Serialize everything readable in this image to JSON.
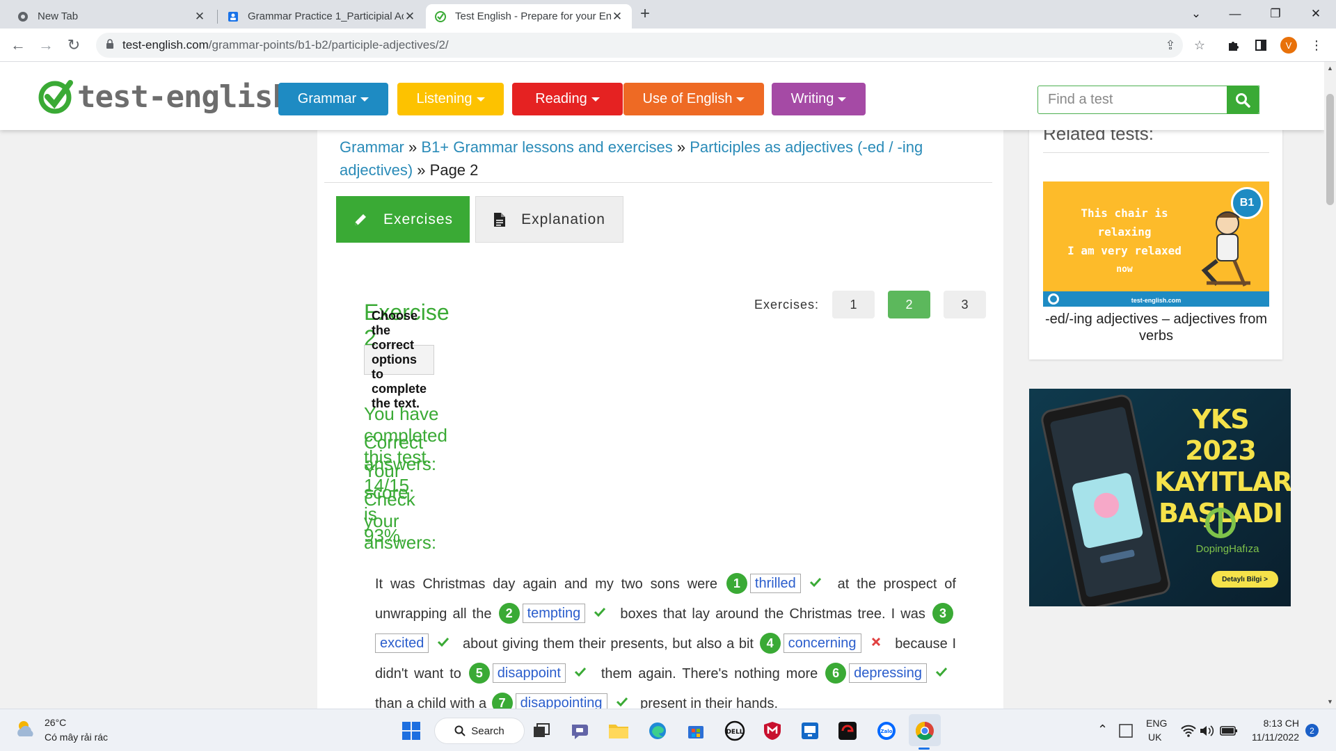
{
  "browser": {
    "tabs": [
      {
        "title": "New Tab",
        "active": false
      },
      {
        "title": "Grammar Practice 1_Participial Ac",
        "active": false
      },
      {
        "title": "Test English - Prepare for your En",
        "active": true
      }
    ],
    "url_domain": "test-english.com",
    "url_path": "/grammar-points/b1-b2/participle-adjectives/2/",
    "profile_initial": "V"
  },
  "site": {
    "logo_text": "test-english",
    "menu": [
      {
        "label": "Grammar",
        "color": "#1e8bc3"
      },
      {
        "label": "Listening",
        "color": "#fdc200"
      },
      {
        "label": "Reading",
        "color": "#e52222"
      },
      {
        "label": "Use of English",
        "color": "#ee6a24"
      },
      {
        "label": "Writing",
        "color": "#a54aa5"
      }
    ],
    "search_placeholder": "Find a test"
  },
  "breadcrumb": {
    "items": [
      "Grammar",
      "B1+ Grammar lessons and exercises",
      "Participles as adjectives (-ed / -ing adjectives)"
    ],
    "current": "Page 2",
    "separator": "»"
  },
  "tabs": {
    "exercises": "Exercises",
    "explanation": "Explanation"
  },
  "exercise": {
    "title": "Exercise 2",
    "selector_label": "Exercises:",
    "numbers": [
      "1",
      "2",
      "3"
    ],
    "current": "2",
    "instruction": "Choose the correct options to complete the text."
  },
  "results": {
    "completed": "You have completed this test.",
    "correct": "Correct answers: 14/15.",
    "score": "Your score is 93%.",
    "check": "Check your answers:"
  },
  "passage": {
    "t0": "It was Christmas day again and my two sons were",
    "t1": "at the prospect of unwrapping all the",
    "t2": "boxes that lay around the Christmas tree. I was",
    "t3": "about giving them their presents, but also a bit",
    "t4": "because I didn't want to",
    "t5": "them again. There's nothing more",
    "t6": "than a child with a",
    "t7": "present in their hands.",
    "answers": [
      {
        "n": "1",
        "word": "thrilled",
        "correct": true
      },
      {
        "n": "2",
        "word": "tempting",
        "correct": true
      },
      {
        "n": "3",
        "word": "excited",
        "correct": true
      },
      {
        "n": "4",
        "word": "concerning",
        "correct": false
      },
      {
        "n": "5",
        "word": "disappoint",
        "correct": true
      },
      {
        "n": "6",
        "word": "depressing",
        "correct": true
      },
      {
        "n": "7",
        "word": "disappointing",
        "correct": true
      }
    ]
  },
  "sidebar": {
    "related_title": "Related tests:",
    "image_lines": [
      "This chair is relaxing",
      "I am very relaxed",
      "now"
    ],
    "image_badge": "B1",
    "image_footer": "test-english.com",
    "caption": "-ed/-ing adjectives – adjectives from verbs",
    "ad_lines": [
      "YKS 2023",
      "KAYITLARI",
      "BAŞLADI"
    ],
    "ad_brand": "DopingHafıza",
    "ad_button": "Detaylı Bilgi >"
  },
  "taskbar": {
    "weather_temp": "26°C",
    "weather_desc": "Có mây rải rác",
    "search_label": "Search",
    "lang": "ENG",
    "region": "UK",
    "time": "8:13 CH",
    "date": "11/11/2022",
    "notifications": "2"
  }
}
